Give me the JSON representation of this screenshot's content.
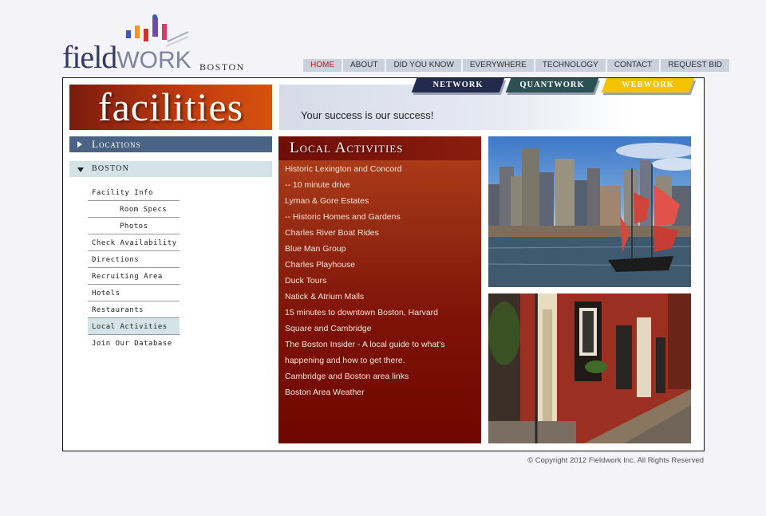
{
  "logo": {
    "text_a": "field",
    "text_b": "WORK",
    "city": "BOSTON",
    "bar_colors": [
      "#3b59b5",
      "#f0952a",
      "#c8362a",
      "#6f4aa6",
      "#d33b6b"
    ]
  },
  "top_nav": {
    "items": [
      {
        "label": "HOME",
        "active": true
      },
      {
        "label": "ABOUT"
      },
      {
        "label": "DID YOU KNOW"
      },
      {
        "label": "EVERYWHERE"
      },
      {
        "label": "TECHNOLOGY"
      },
      {
        "label": "CONTACT"
      },
      {
        "label": "REQUEST BID"
      }
    ]
  },
  "brand_tabs": {
    "network": "NETWORK",
    "quantwork": "QUANTWORK",
    "webwork": "WEBWORK"
  },
  "banner": {
    "title": "facilities",
    "tagline": "Your success is our success!"
  },
  "left_nav": {
    "locations_label": "Locations",
    "city_label": "BOSTON",
    "items": [
      {
        "label": "Facility Info"
      },
      {
        "label": "Room Specs",
        "indent": true
      },
      {
        "label": "Photos",
        "indent": true
      },
      {
        "label": "Check Availability"
      },
      {
        "label": "Directions"
      },
      {
        "label": "Recruiting Area"
      },
      {
        "label": "Hotels"
      },
      {
        "label": "Restaurants"
      },
      {
        "label": "Local Activities",
        "active": true
      },
      {
        "label": "Join Our Database"
      }
    ]
  },
  "activities": {
    "title": "Local Activities",
    "items": [
      "Historic Lexington and Concord",
      "-- 10 minute drive",
      "Lyman & Gore Estates",
      "-- Historic Homes and Gardens",
      "Charles River Boat Rides",
      "Blue Man Group",
      "Charles Playhouse",
      "Duck Tours",
      "Natick & Atrium Malls",
      "15 minutes to downtown Boston, Harvard",
      "Square and Cambridge",
      "The Boston Insider - A local guide to what's",
      "happening and how to get there.",
      "Cambridge and Boston area links",
      "Boston Area Weather"
    ]
  },
  "footer": {
    "copyright": "© Copyright 2012 Fieldwork Inc. All Rights Reserved"
  }
}
